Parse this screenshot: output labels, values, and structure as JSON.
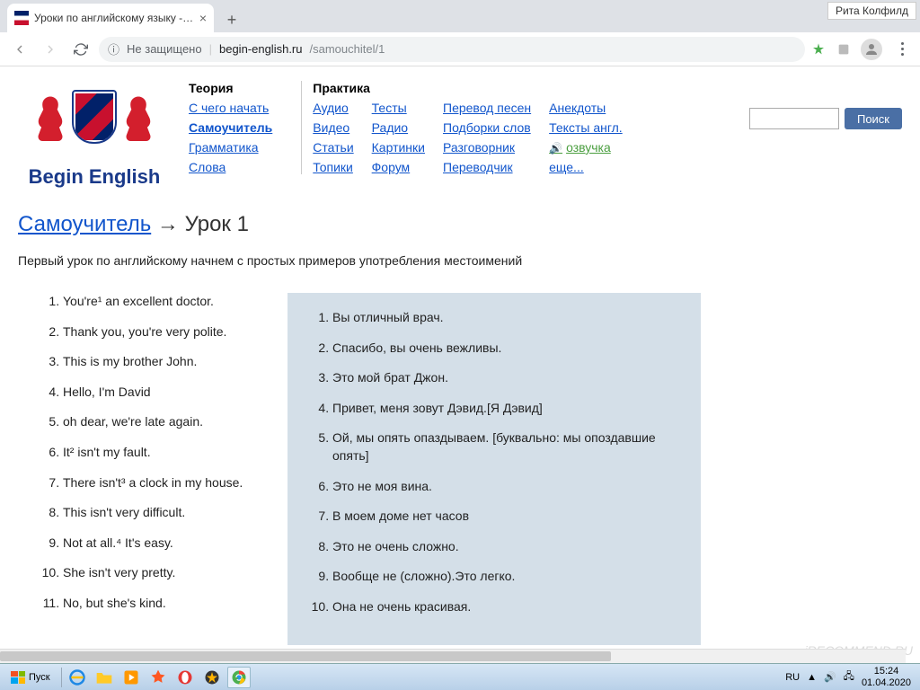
{
  "browser": {
    "tab_title": "Уроки по английскому языку - Уро",
    "user_badge": "Рита Колфилд",
    "url_insecure": "Не защищено",
    "url_domain": "begin-english.ru",
    "url_path": "/samouchitel/1"
  },
  "logo_text": "Begin English",
  "nav": {
    "theory": {
      "header": "Теория",
      "items": [
        "С чего начать",
        "Самоучитель",
        "Грамматика",
        "Слова"
      ]
    },
    "practice": {
      "header": "Практика",
      "col1": [
        "Аудио",
        "Видео",
        "Статьи",
        "Топики"
      ],
      "col2": [
        "Тесты",
        "Радио",
        "Картинки",
        "Форум"
      ],
      "col3": [
        "Перевод песен",
        "Подборки слов",
        "Разговорник",
        "Переводчик"
      ],
      "col4": [
        "Анекдоты",
        "Тексты англ.",
        "озвучка",
        "еще..."
      ]
    }
  },
  "search_btn": "Поиск",
  "breadcrumb": {
    "parent": "Самоучитель",
    "arrow": "→",
    "current": "Урок 1"
  },
  "intro": "Первый урок по английскому начнем с простых примеров употребления местоимений",
  "english_list": [
    "You're¹ an excellent doctor.",
    "Thank you, you're very polite.",
    "This is my brother John.",
    "Hello, I'm David",
    "oh dear, we're late again.",
    "It² isn't my fault.",
    "There isn't³ a clock in my house.",
    "This isn't very difficult.",
    "Not at all.⁴ It's easy.",
    "She isn't very pretty.",
    "No, but she's kind."
  ],
  "russian_list": [
    "Вы отличный врач.",
    "Спасибо, вы очень вежливы.",
    "Это мой брат Джон.",
    "Привет, меня зовут Дэвид.[Я Дэвид]",
    "Ой, мы опять опаздываем. [буквально: мы опоздавшие опять]",
    "Это не моя вина.",
    "В моем доме нет часов",
    "Это не очень сложно.",
    "Вообще не (сложно).Это легко.",
    "Она не очень красивая."
  ],
  "taskbar": {
    "start": "Пуск",
    "lang": "RU",
    "time": "15:24",
    "date": "01.04.2020"
  },
  "watermark": "iRECOMMEND.RU"
}
